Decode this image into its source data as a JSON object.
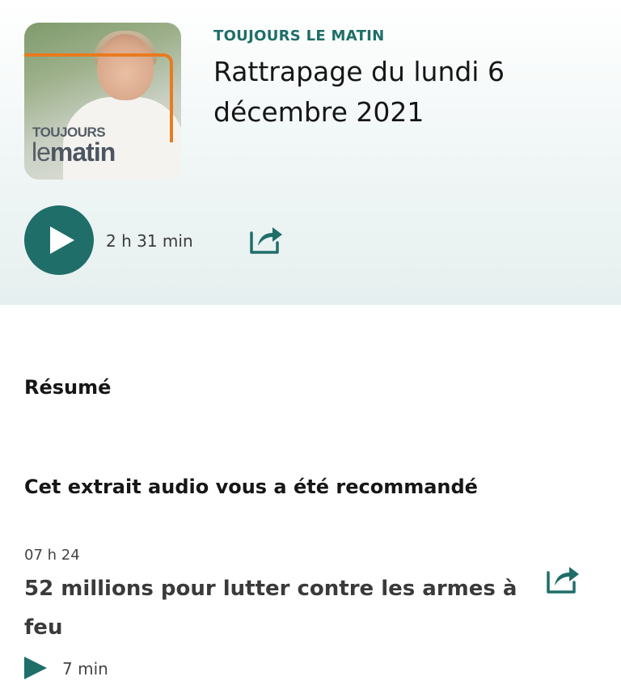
{
  "colors": {
    "accent": "#1f6e69",
    "cover_orange": "#e97a20",
    "text_dark": "#161616"
  },
  "cover": {
    "brand_line1": "TOUJOURS",
    "brand_line2_light": "le",
    "brand_line2_bold": "matin"
  },
  "episode": {
    "show_name": "TOUJOURS LE MATIN",
    "title": "Rattrapage du lundi 6 décembre 2021",
    "duration": "2 h 31 min",
    "play_icon": "play-icon",
    "share_icon": "share-icon"
  },
  "summary": {
    "heading": "Résumé"
  },
  "recommendation": {
    "heading": "Cet extrait audio vous a été recommandé",
    "clip": {
      "time": "07 h 24",
      "title": "52 millions pour lutter contre les armes à feu",
      "duration": "7 min",
      "play_icon": "play-icon",
      "share_icon": "share-icon"
    }
  }
}
